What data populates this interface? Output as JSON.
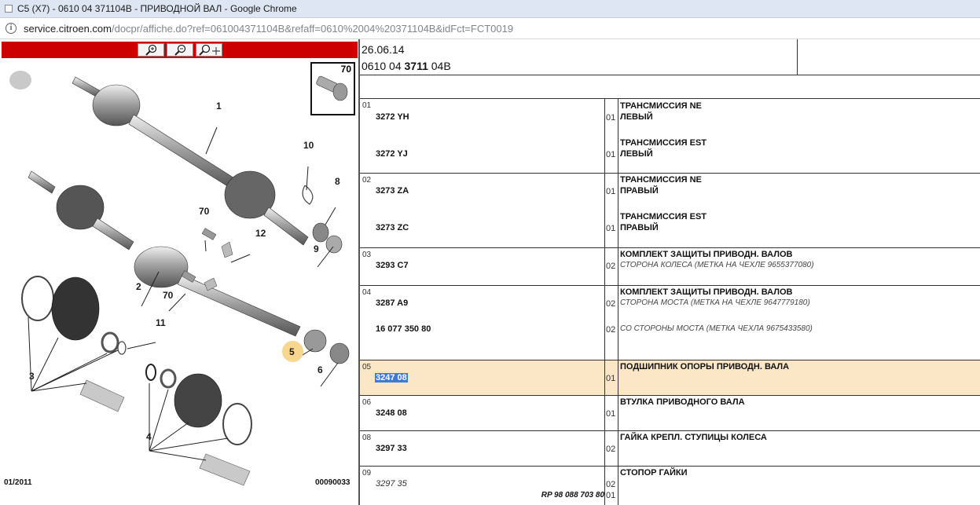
{
  "window": {
    "title": "C5 (X7) - 0610 04 371104B - ПРИВОДНОЙ ВАЛ - Google Chrome"
  },
  "address": {
    "host": "service.citroen.com",
    "path": "/docpr/affiche.do?ref=061004371104B&refaff=0610%2004%20371104B&idFct=FCT0019"
  },
  "drawing": {
    "labels": {
      "l1": "1",
      "l2": "2",
      "l3": "3",
      "l4": "4",
      "l5": "5",
      "l6": "6",
      "l8": "8",
      "l9": "9",
      "l10": "10",
      "l11": "11",
      "l12": "12",
      "l70a": "70",
      "l70b": "70",
      "inset": "70"
    },
    "footer_left": "01/2011",
    "footer_right": "00090033"
  },
  "header": {
    "date": "26.06.14",
    "code_pre": "0610 04 ",
    "code_bold": "3711",
    "code_post": " 04B"
  },
  "rows": [
    {
      "num": "01",
      "parts": [
        {
          "pn": "3272 YH",
          "qty": "01",
          "d1": "ТРАНСМИССИЯ NE",
          "d2": "ЛЕВЫЙ"
        },
        {
          "pn": "3272 YJ",
          "qty": "01",
          "d1": "ТРАНСМИССИЯ EST",
          "d2": "ЛЕВЫЙ"
        }
      ]
    },
    {
      "num": "02",
      "parts": [
        {
          "pn": "3273 ZA",
          "qty": "01",
          "d1": "ТРАНСМИССИЯ NE",
          "d2": "ПРАВЫЙ"
        },
        {
          "pn": "3273 ZC",
          "qty": "01",
          "d1": "ТРАНСМИССИЯ EST",
          "d2": "ПРАВЫЙ"
        }
      ]
    },
    {
      "num": "03",
      "parts": [
        {
          "pn": "3293 C7",
          "qty": "02",
          "d1": "КОМПЛЕКТ ЗАЩИТЫ ПРИВОДН. ВАЛОВ",
          "d2": "СТОРОНА КОЛЕСА (МЕТКА НА ЧЕХЛЕ 9655377080)"
        }
      ]
    },
    {
      "num": "04",
      "parts": [
        {
          "pn": "3287 A9",
          "qty": "02",
          "d1": "КОМПЛЕКТ ЗАЩИТЫ ПРИВОДН. ВАЛОВ",
          "d2": "СТОРОНА МОСТА (МЕТКА НА ЧЕХЛЕ 9647779180)"
        },
        {
          "pn": "16 077 350 80",
          "qty": "02",
          "d2": "СО СТОРОНЫ МОСТА (МЕТКА ЧЕХЛА 9675433580)"
        }
      ]
    },
    {
      "num": "05",
      "parts": [
        {
          "pn": "3247 08",
          "qty": "01",
          "d1": "ПОДШИПНИК ОПОРЫ ПРИВОДН. ВАЛА"
        }
      ]
    },
    {
      "num": "06",
      "parts": [
        {
          "pn": "3248 08",
          "qty": "01",
          "d1": "ВТУЛКА ПРИВОДНОГО ВАЛА"
        }
      ]
    },
    {
      "num": "08",
      "parts": [
        {
          "pn": "3297 33",
          "qty": "02",
          "d1": "ГАЙКА КРЕПЛ. СТУПИЦЫ КОЛЕСА"
        }
      ]
    },
    {
      "num": "09",
      "parts": [
        {
          "pn": "3297 35",
          "qty": "02",
          "d1": "СТОПОР ГАЙКИ",
          "rp": "RP 98 088 703 80",
          "qty2": "01"
        }
      ]
    }
  ]
}
